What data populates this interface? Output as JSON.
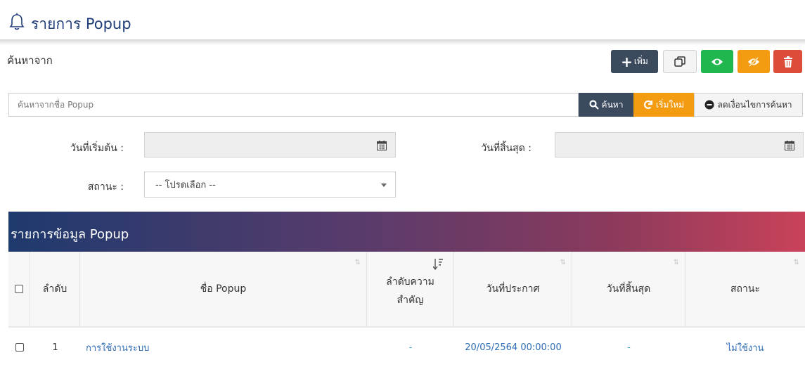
{
  "header": {
    "title": "รายการ Popup"
  },
  "toolbar": {
    "search_from_label": "ค้นหาจาก",
    "add_label": "เพิ่ม"
  },
  "search": {
    "placeholder": "ค้นหาจากชื่อ Popup",
    "search_label": "ค้นหา",
    "reset_label": "เริ่มใหม่",
    "less_label": "ลดเงื่อนไขการค้นหา"
  },
  "filters": {
    "start_date_label": "วันที่เริ่มต้น :",
    "end_date_label": "วันที่สิ้นสุด :",
    "status_label": "สถานะ :",
    "status_value": "-- โปรดเลือก --"
  },
  "panel": {
    "title": "รายการข้อมูล Popup"
  },
  "table": {
    "columns": {
      "order": "ลำดับ",
      "name": "ชื่อ Popup",
      "priority_line1": "ลำดับความ",
      "priority_line2": "สำคัญ",
      "announce_date": "วันที่ประกาศ",
      "end_date": "วันที่สิ้นสุด",
      "status": "สถานะ"
    },
    "rows": [
      {
        "order": "1",
        "name": "การใช้งานระบบ",
        "priority": "-",
        "announce_date": "20/05/2564 00:00:00",
        "end_date": "-",
        "status": "ไม่ใช้งาน"
      }
    ]
  },
  "colors": {
    "primary": "#1f3d7a",
    "add": "#3b4a5c",
    "show": "#1fb74e",
    "hide": "#f39c12",
    "delete": "#dd4b39",
    "link": "#2f6db5"
  },
  "icons": [
    "bell-icon",
    "plus-icon",
    "duplicate-icon",
    "eye-icon",
    "eye-slash-icon",
    "trash-icon",
    "search-icon",
    "refresh-icon",
    "minus-circle-icon",
    "calendar-icon",
    "sort-icon",
    "sort-desc-icon"
  ]
}
